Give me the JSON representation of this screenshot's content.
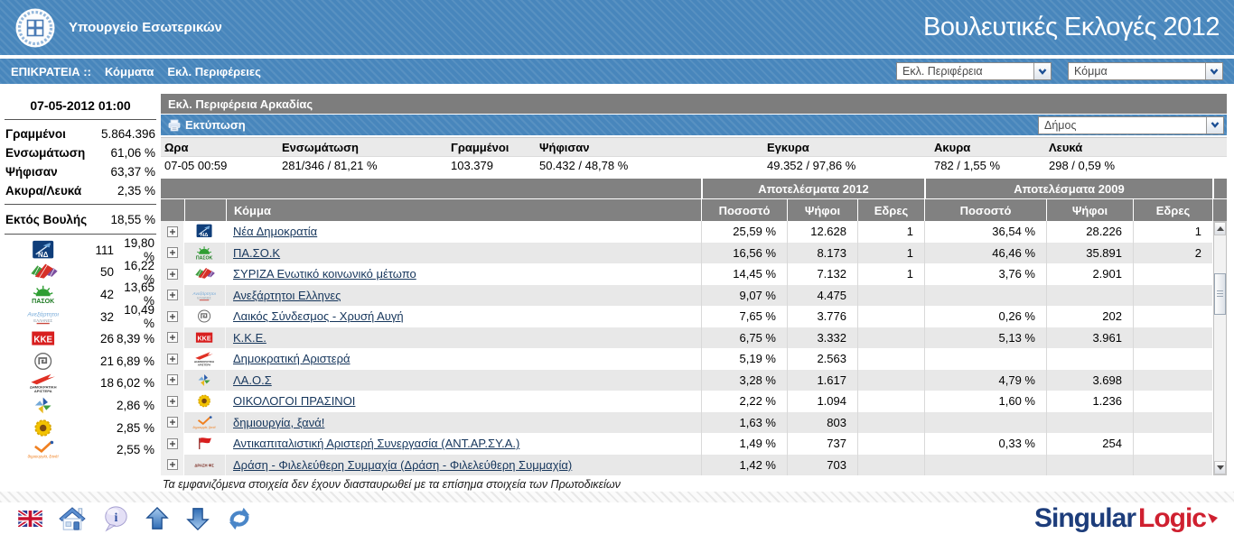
{
  "header": {
    "ministry_label": "Υπουργείο Εσωτερικών",
    "election_title": "Βουλευτικές Εκλογές 2012"
  },
  "nav": {
    "territory_label": "ΕΠΙΚΡΑΤΕΙΑ ::",
    "parties_link": "Κόμματα",
    "districts_link": "Εκλ. Περιφέρειες",
    "district_dropdown_label": "Εκλ. Περιφέρεια",
    "party_dropdown_label": "Κόμμα"
  },
  "sidebar": {
    "timestamp": "07-05-2012 01:00",
    "stats": [
      {
        "label": "Γραμμένοι",
        "value": "5.864.396"
      },
      {
        "label": "Ενσωμάτωση",
        "value": "61,06 %"
      },
      {
        "label": "Ψήφισαν",
        "value": "63,37 %"
      },
      {
        "label": "Ακυρα/Λευκά",
        "value": "2,35 %"
      }
    ],
    "outside_parliament": {
      "label": "Εκτός Βουλής",
      "value": "18,55 %"
    },
    "parties": [
      {
        "logo": "nd",
        "seats": "111",
        "pct": "19,80 %"
      },
      {
        "logo": "syriza",
        "seats": "50",
        "pct": "16,22 %"
      },
      {
        "logo": "pasok",
        "seats": "42",
        "pct": "13,65 %"
      },
      {
        "logo": "anel",
        "seats": "32",
        "pct": "10,49 %"
      },
      {
        "logo": "kke",
        "seats": "26",
        "pct": "8,39 %"
      },
      {
        "logo": "xa",
        "seats": "21",
        "pct": "6,89 %"
      },
      {
        "logo": "dimar",
        "seats": "18",
        "pct": "6,02 %"
      },
      {
        "logo": "laos",
        "seats": "",
        "pct": "2,86 %"
      },
      {
        "logo": "oikologoi",
        "seats": "",
        "pct": "2,85 %"
      },
      {
        "logo": "dimiourgia",
        "seats": "",
        "pct": "2,55 %"
      }
    ]
  },
  "main": {
    "district_title": "Εκλ. Περιφέρεια Αρκαδίας",
    "print_label": "Εκτύπωση",
    "municipality_dropdown_label": "Δήμος",
    "summary": {
      "headers": [
        "Ωρα",
        "Ενσωμάτωση",
        "Γραμμένοι",
        "Ψήφισαν",
        "Εγκυρα",
        "Ακυρα",
        "Λευκά"
      ],
      "values": [
        "07-05 00:59",
        "281/346 / 81,21 %",
        "103.379",
        "50.432 / 48,78 %",
        "49.352 / 97,86 %",
        "782 / 1,55 %",
        "298 / 0,59 %"
      ]
    },
    "results": {
      "group_2012_label": "Αποτελέσματα 2012",
      "group_2009_label": "Αποτελέσματα 2009",
      "party_header": "Κόμμα",
      "sub_headers": [
        "Ποσοστό",
        "Ψήφοι",
        "Εδρες"
      ],
      "rows": [
        {
          "logo": "nd",
          "party": "Νέα Δημοκρατία",
          "p12": "25,59 %",
          "v12": "12.628",
          "s12": "1",
          "p09": "36,54 %",
          "v09": "28.226",
          "s09": "1"
        },
        {
          "logo": "pasok",
          "party": "ΠΑ.ΣΟ.Κ",
          "p12": "16,56 %",
          "v12": "8.173",
          "s12": "1",
          "p09": "46,46 %",
          "v09": "35.891",
          "s09": "2"
        },
        {
          "logo": "syriza",
          "party": "ΣΥΡΙΖΑ Ενωτικό κοινωνικό μέτωπο",
          "p12": "14,45 %",
          "v12": "7.132",
          "s12": "1",
          "p09": "3,76 %",
          "v09": "2.901",
          "s09": ""
        },
        {
          "logo": "anel",
          "party": "Ανεξάρτητοι Ελληνες",
          "p12": "9,07 %",
          "v12": "4.475",
          "s12": "",
          "p09": "",
          "v09": "",
          "s09": ""
        },
        {
          "logo": "xa",
          "party": "Λαικός Σύνδεσμος - Χρυσή Αυγή",
          "p12": "7,65 %",
          "v12": "3.776",
          "s12": "",
          "p09": "0,26 %",
          "v09": "202",
          "s09": ""
        },
        {
          "logo": "kke",
          "party": "Κ.Κ.Ε.",
          "p12": "6,75 %",
          "v12": "3.332",
          "s12": "",
          "p09": "5,13 %",
          "v09": "3.961",
          "s09": ""
        },
        {
          "logo": "dimar",
          "party": "Δημοκρατική Αριστερά",
          "p12": "5,19 %",
          "v12": "2.563",
          "s12": "",
          "p09": "",
          "v09": "",
          "s09": ""
        },
        {
          "logo": "laos",
          "party": "ΛΑ.Ο.Σ",
          "p12": "3,28 %",
          "v12": "1.617",
          "s12": "",
          "p09": "4,79 %",
          "v09": "3.698",
          "s09": ""
        },
        {
          "logo": "oikologoi",
          "party": "ΟΙΚΟΛΟΓΟΙ ΠΡΑΣΙΝΟΙ",
          "p12": "2,22 %",
          "v12": "1.094",
          "s12": "",
          "p09": "1,60 %",
          "v09": "1.236",
          "s09": ""
        },
        {
          "logo": "dimiourgia",
          "party": "δημιουργία, ξανά!",
          "p12": "1,63 %",
          "v12": "803",
          "s12": "",
          "p09": "",
          "v09": "",
          "s09": ""
        },
        {
          "logo": "antarsya",
          "party": "Αντικαπιταλιστική Αριστερή Συνεργασία (ΑΝΤ.ΑΡ.ΣΥ.Α.)",
          "p12": "1,49 %",
          "v12": "737",
          "s12": "",
          "p09": "0,33 %",
          "v09": "254",
          "s09": ""
        },
        {
          "logo": "drasi",
          "party": "Δράση - Φιλελεύθερη Συμμαχία (Δράση - Φιλελεύθερη Συμμαχία)",
          "p12": "1,42 %",
          "v12": "703",
          "s12": "",
          "p09": "",
          "v09": "",
          "s09": ""
        }
      ]
    },
    "disclaimer": "Τα εμφανιζόμενα στοιχεία δεν έχουν διασταυρωθεί με τα επίσημα στοιχεία των Πρωτοδικείων"
  },
  "footer": {
    "icons": [
      "uk-flag",
      "home",
      "info",
      "arrow-up",
      "arrow-down",
      "refresh"
    ],
    "brand_part1": "Singular",
    "brand_part2": "Logic"
  },
  "colors": {
    "header_blue": "#4886bc",
    "bar_gray": "#7d7d7d",
    "link_navy": "#16365c",
    "brand_blue": "#1d3d7b",
    "brand_red": "#cf2030"
  }
}
